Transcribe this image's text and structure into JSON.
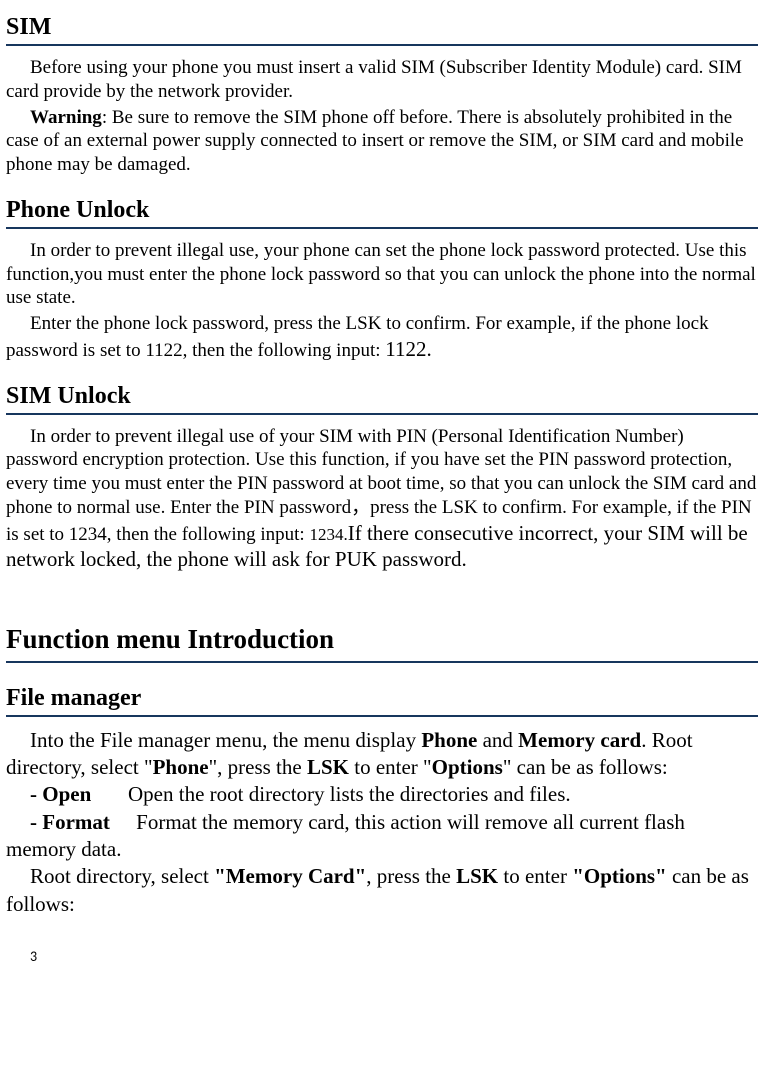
{
  "sim": {
    "heading": "SIM",
    "p1": "Before using your phone you must insert a valid SIM (Subscriber Identity Module) card. SIM card provide by the network provider.",
    "warning_label": "Warning",
    "warning_text": ": Be sure to remove the SIM phone off before. There is absolutely prohibited in the case of an external power supply connected to insert or remove the SIM, or SIM card and mobile phone may be damaged."
  },
  "phone_unlock": {
    "heading": "Phone Unlock",
    "p1": "In order to prevent illegal use, your phone can set the phone lock password protected. Use this function,you must enter the phone lock password so that you can unlock the phone into the normal use state.",
    "p2_a": "Enter the phone lock password, press the LSK to confirm. For example, if the phone lock password is set to 1122, then the following input: ",
    "p2_b": "1122."
  },
  "sim_unlock": {
    "heading": "SIM Unlock",
    "p1_a": "In order to prevent illegal use of your SIM with PIN (Personal Identification Number) password encryption protection. Use this function, if you have set the PIN password protection, every time you must enter the PIN password at boot time, so that you can unlock the SIM card and phone to normal use. Enter the PIN password，press the LSK to confirm. For example, if the PIN is set to 1234, then the following input: ",
    "p1_b": "1234.",
    "p1_c": "If there consecutive incorrect, your SIM will be network locked, the phone will ask for PUK password."
  },
  "func_menu": {
    "heading": "Function menu Introduction"
  },
  "file_manager": {
    "heading": "File manager",
    "intro_a": "Into the File manager menu, the menu display ",
    "phone_bold": "Phone",
    "intro_b": " and ",
    "memcard_bold": "Memory card",
    "intro_c": ". Root directory, select \"",
    "phone_bold2": "Phone",
    "intro_d": "\", press the ",
    "lsk_bold": "LSK",
    "intro_e": " to enter \"",
    "options_bold": "Options",
    "intro_f": "\" can be as follows:",
    "open_label": "- Open",
    "open_desc": "       Open the root directory lists the directories and files.",
    "format_label": "- Format",
    "format_desc": "     Format the memory card, this action will remove all current flash memory data.",
    "root2_a": "Root directory, select ",
    "memcard_q": "\"Memory Card\"",
    "root2_b": ", press the ",
    "lsk_bold2": "LSK",
    "root2_c": " to enter ",
    "options_q": "\"Options\"",
    "root2_d": " can be as follows:"
  },
  "page_number": "3"
}
